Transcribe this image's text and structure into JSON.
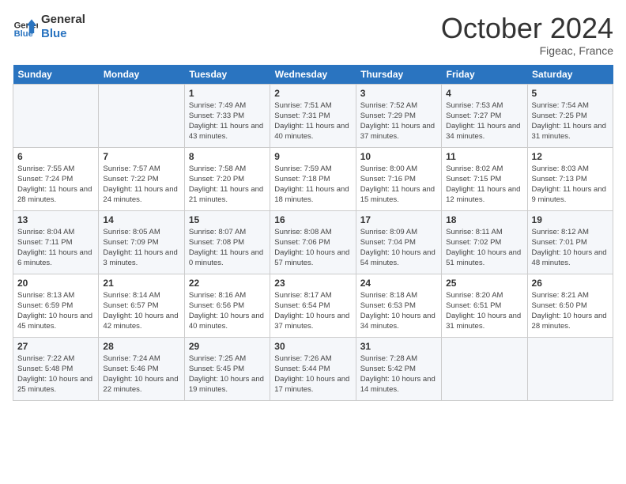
{
  "header": {
    "logo_line1": "General",
    "logo_line2": "Blue",
    "month": "October 2024",
    "location": "Figeac, France"
  },
  "weekdays": [
    "Sunday",
    "Monday",
    "Tuesday",
    "Wednesday",
    "Thursday",
    "Friday",
    "Saturday"
  ],
  "weeks": [
    [
      {
        "day": "",
        "info": ""
      },
      {
        "day": "",
        "info": ""
      },
      {
        "day": "1",
        "info": "Sunrise: 7:49 AM\nSunset: 7:33 PM\nDaylight: 11 hours and 43 minutes."
      },
      {
        "day": "2",
        "info": "Sunrise: 7:51 AM\nSunset: 7:31 PM\nDaylight: 11 hours and 40 minutes."
      },
      {
        "day": "3",
        "info": "Sunrise: 7:52 AM\nSunset: 7:29 PM\nDaylight: 11 hours and 37 minutes."
      },
      {
        "day": "4",
        "info": "Sunrise: 7:53 AM\nSunset: 7:27 PM\nDaylight: 11 hours and 34 minutes."
      },
      {
        "day": "5",
        "info": "Sunrise: 7:54 AM\nSunset: 7:25 PM\nDaylight: 11 hours and 31 minutes."
      }
    ],
    [
      {
        "day": "6",
        "info": "Sunrise: 7:55 AM\nSunset: 7:24 PM\nDaylight: 11 hours and 28 minutes."
      },
      {
        "day": "7",
        "info": "Sunrise: 7:57 AM\nSunset: 7:22 PM\nDaylight: 11 hours and 24 minutes."
      },
      {
        "day": "8",
        "info": "Sunrise: 7:58 AM\nSunset: 7:20 PM\nDaylight: 11 hours and 21 minutes."
      },
      {
        "day": "9",
        "info": "Sunrise: 7:59 AM\nSunset: 7:18 PM\nDaylight: 11 hours and 18 minutes."
      },
      {
        "day": "10",
        "info": "Sunrise: 8:00 AM\nSunset: 7:16 PM\nDaylight: 11 hours and 15 minutes."
      },
      {
        "day": "11",
        "info": "Sunrise: 8:02 AM\nSunset: 7:15 PM\nDaylight: 11 hours and 12 minutes."
      },
      {
        "day": "12",
        "info": "Sunrise: 8:03 AM\nSunset: 7:13 PM\nDaylight: 11 hours and 9 minutes."
      }
    ],
    [
      {
        "day": "13",
        "info": "Sunrise: 8:04 AM\nSunset: 7:11 PM\nDaylight: 11 hours and 6 minutes."
      },
      {
        "day": "14",
        "info": "Sunrise: 8:05 AM\nSunset: 7:09 PM\nDaylight: 11 hours and 3 minutes."
      },
      {
        "day": "15",
        "info": "Sunrise: 8:07 AM\nSunset: 7:08 PM\nDaylight: 11 hours and 0 minutes."
      },
      {
        "day": "16",
        "info": "Sunrise: 8:08 AM\nSunset: 7:06 PM\nDaylight: 10 hours and 57 minutes."
      },
      {
        "day": "17",
        "info": "Sunrise: 8:09 AM\nSunset: 7:04 PM\nDaylight: 10 hours and 54 minutes."
      },
      {
        "day": "18",
        "info": "Sunrise: 8:11 AM\nSunset: 7:02 PM\nDaylight: 10 hours and 51 minutes."
      },
      {
        "day": "19",
        "info": "Sunrise: 8:12 AM\nSunset: 7:01 PM\nDaylight: 10 hours and 48 minutes."
      }
    ],
    [
      {
        "day": "20",
        "info": "Sunrise: 8:13 AM\nSunset: 6:59 PM\nDaylight: 10 hours and 45 minutes."
      },
      {
        "day": "21",
        "info": "Sunrise: 8:14 AM\nSunset: 6:57 PM\nDaylight: 10 hours and 42 minutes."
      },
      {
        "day": "22",
        "info": "Sunrise: 8:16 AM\nSunset: 6:56 PM\nDaylight: 10 hours and 40 minutes."
      },
      {
        "day": "23",
        "info": "Sunrise: 8:17 AM\nSunset: 6:54 PM\nDaylight: 10 hours and 37 minutes."
      },
      {
        "day": "24",
        "info": "Sunrise: 8:18 AM\nSunset: 6:53 PM\nDaylight: 10 hours and 34 minutes."
      },
      {
        "day": "25",
        "info": "Sunrise: 8:20 AM\nSunset: 6:51 PM\nDaylight: 10 hours and 31 minutes."
      },
      {
        "day": "26",
        "info": "Sunrise: 8:21 AM\nSunset: 6:50 PM\nDaylight: 10 hours and 28 minutes."
      }
    ],
    [
      {
        "day": "27",
        "info": "Sunrise: 7:22 AM\nSunset: 5:48 PM\nDaylight: 10 hours and 25 minutes."
      },
      {
        "day": "28",
        "info": "Sunrise: 7:24 AM\nSunset: 5:46 PM\nDaylight: 10 hours and 22 minutes."
      },
      {
        "day": "29",
        "info": "Sunrise: 7:25 AM\nSunset: 5:45 PM\nDaylight: 10 hours and 19 minutes."
      },
      {
        "day": "30",
        "info": "Sunrise: 7:26 AM\nSunset: 5:44 PM\nDaylight: 10 hours and 17 minutes."
      },
      {
        "day": "31",
        "info": "Sunrise: 7:28 AM\nSunset: 5:42 PM\nDaylight: 10 hours and 14 minutes."
      },
      {
        "day": "",
        "info": ""
      },
      {
        "day": "",
        "info": ""
      }
    ]
  ]
}
